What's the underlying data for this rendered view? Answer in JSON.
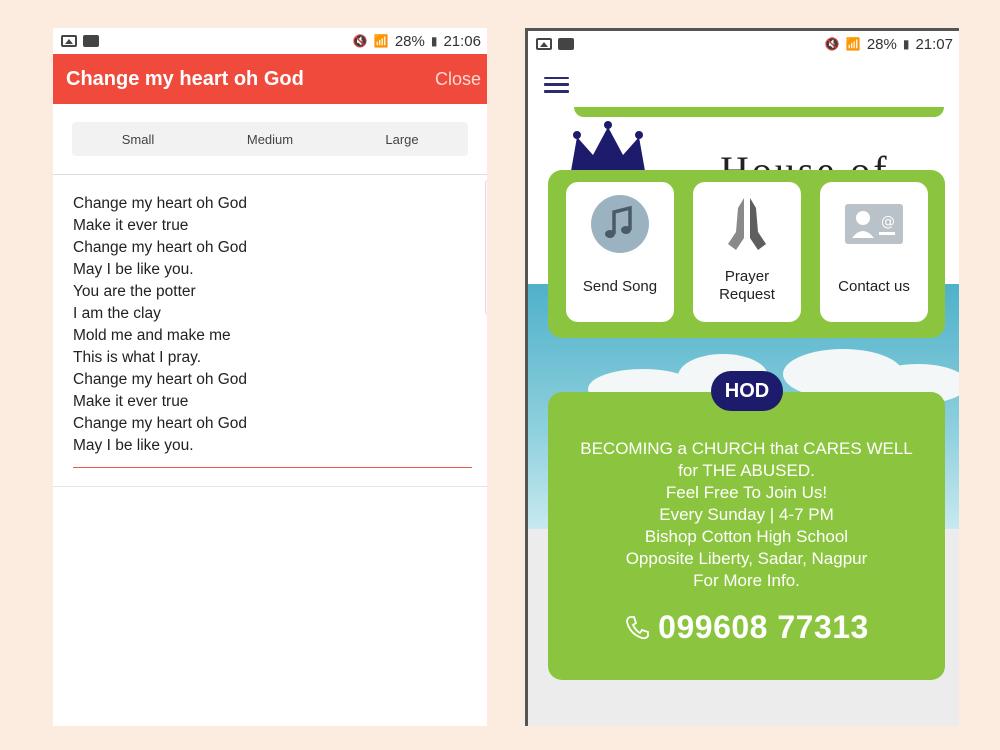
{
  "left_screen": {
    "status": {
      "battery": "28%",
      "time": "21:06"
    },
    "header": {
      "title": "Change my heart oh God",
      "close_label": "Close"
    },
    "font_sizes": [
      "Small",
      "Medium",
      "Large"
    ],
    "lyrics": [
      "Change my heart oh God",
      "Make it ever true",
      "Change my heart oh God",
      "May I be like you.",
      "You are the potter",
      "I am the clay",
      "Mold me and make me",
      "This is what I pray.",
      "Change my heart oh God",
      "Make it ever true",
      "Change my heart oh God",
      "May I be like you."
    ]
  },
  "right_screen": {
    "status": {
      "battery": "28%",
      "time": "21:07"
    },
    "logo_text": "House of",
    "quick_actions": [
      {
        "label": "Send Song",
        "icon": "music-note-icon"
      },
      {
        "label": "Prayer Request",
        "icon": "praying-hands-icon"
      },
      {
        "label": "Contact us",
        "icon": "contact-card-icon"
      }
    ],
    "badge": "HOD",
    "info_lines": [
      "BECOMING a CHURCH that CARES WELL",
      "for THE ABUSED.",
      "Feel Free To Join Us!",
      "Every Sunday | 4-7 PM",
      "Bishop Cotton High School",
      "Opposite Liberty, Sadar, Nagpur",
      "For More Info."
    ],
    "phone_number": "099608 77313"
  },
  "colors": {
    "header_red": "#f04a3c",
    "panel_green": "#8bc53f",
    "badge_navy": "#1d1b6b",
    "page_background": "#fcebdf"
  }
}
